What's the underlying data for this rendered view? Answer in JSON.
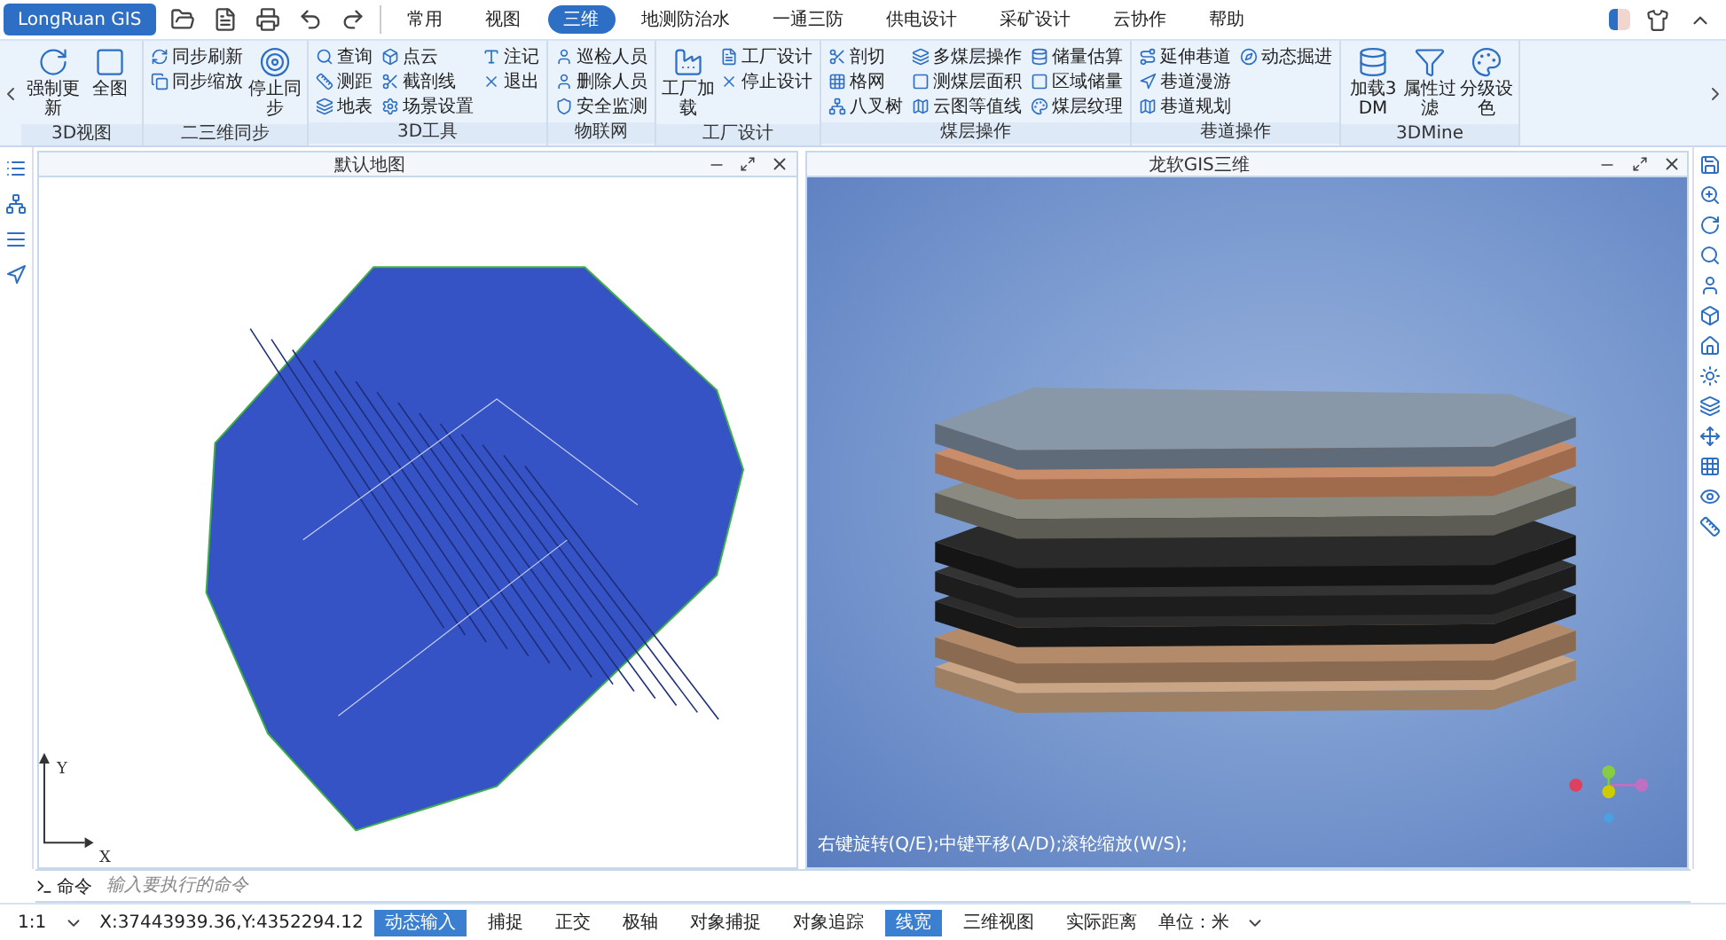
{
  "app_button": "LongRuan GIS",
  "menu": [
    {
      "label": "常用",
      "selected": false
    },
    {
      "label": "视图",
      "selected": false
    },
    {
      "label": "三维",
      "selected": true
    },
    {
      "label": "地测防治水",
      "selected": false
    },
    {
      "label": "一通三防",
      "selected": false
    },
    {
      "label": "供电设计",
      "selected": false
    },
    {
      "label": "采矿设计",
      "selected": false
    },
    {
      "label": "云协作",
      "selected": false
    },
    {
      "label": "帮助",
      "selected": false
    }
  ],
  "ribbon": {
    "groups": [
      {
        "title": "3D视图",
        "items": [
          {
            "label": "强制更新",
            "kind": "large"
          },
          {
            "label": "全图",
            "kind": "large"
          }
        ]
      },
      {
        "title": "二三维同步",
        "items": [
          {
            "label": "同步刷新",
            "kind": "small"
          },
          {
            "label": "同步缩放",
            "kind": "small"
          },
          {
            "label": "停止同步",
            "kind": "large"
          }
        ]
      },
      {
        "title": "3D工具",
        "items": [
          {
            "label": "查询",
            "kind": "small"
          },
          {
            "label": "测距",
            "kind": "small"
          },
          {
            "label": "地表",
            "kind": "small"
          },
          {
            "label": "点云",
            "kind": "small"
          },
          {
            "label": "截剖线",
            "kind": "small"
          },
          {
            "label": "场景设置",
            "kind": "small"
          },
          {
            "label": "注记",
            "kind": "small"
          },
          {
            "label": "退出",
            "kind": "small"
          }
        ]
      },
      {
        "title": "物联网",
        "items": [
          {
            "label": "巡检人员",
            "kind": "small"
          },
          {
            "label": "删除人员",
            "kind": "small"
          },
          {
            "label": "安全监测",
            "kind": "small"
          }
        ]
      },
      {
        "title": "工厂设计",
        "items": [
          {
            "label": "工厂加载",
            "kind": "large"
          },
          {
            "label": "工厂设计",
            "kind": "small"
          },
          {
            "label": "停止设计",
            "kind": "small"
          }
        ]
      },
      {
        "title": "煤层操作",
        "items": [
          {
            "label": "剖切",
            "kind": "small"
          },
          {
            "label": "格网",
            "kind": "small"
          },
          {
            "label": "八叉树",
            "kind": "small"
          },
          {
            "label": "多煤层操作",
            "kind": "small"
          },
          {
            "label": "测煤层面积",
            "kind": "small"
          },
          {
            "label": "云图等值线",
            "kind": "small"
          },
          {
            "label": "储量估算",
            "kind": "small"
          },
          {
            "label": "区域储量",
            "kind": "small"
          },
          {
            "label": "煤层纹理",
            "kind": "small"
          }
        ]
      },
      {
        "title": "巷道操作",
        "items": [
          {
            "label": "延伸巷道",
            "kind": "small"
          },
          {
            "label": "巷道漫游",
            "kind": "small"
          },
          {
            "label": "巷道规划",
            "kind": "small"
          },
          {
            "label": "动态掘进",
            "kind": "small"
          }
        ]
      },
      {
        "title": "3DMine",
        "items": [
          {
            "label": "加载3DM",
            "kind": "large"
          },
          {
            "label": "属性过滤",
            "kind": "large"
          },
          {
            "label": "分级设色",
            "kind": "large"
          }
        ]
      }
    ]
  },
  "views": [
    {
      "title": "默认地图",
      "kind": "map",
      "axis_x": "X",
      "axis_y": "Y"
    },
    {
      "title": "龙软GIS三维",
      "kind": "scene",
      "hint": "右键旋转(Q/E);中键平移(A/D);滚轮缩放(W/S);"
    }
  ],
  "command": {
    "label": "命令",
    "placeholder": "输入要执行的命令"
  },
  "status_bar": {
    "scale": "1:1",
    "coords": "X:37443939.36,Y:4352294.12",
    "toggles": [
      {
        "label": "动态输入",
        "selected": true
      },
      {
        "label": "捕捉",
        "selected": false
      },
      {
        "label": "正交",
        "selected": false
      },
      {
        "label": "极轴",
        "selected": false
      },
      {
        "label": "对象捕捉",
        "selected": false
      },
      {
        "label": "对象追踪",
        "selected": false
      },
      {
        "label": "线宽",
        "selected": true
      },
      {
        "label": "三维视图",
        "selected": false
      },
      {
        "label": "实际距离",
        "selected": false
      }
    ],
    "unit": "单位：米"
  }
}
